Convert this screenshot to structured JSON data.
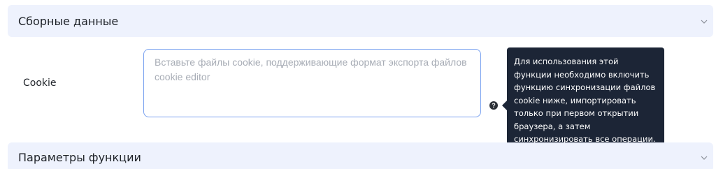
{
  "sections": {
    "combined": {
      "title": "Сборные данные",
      "icon": "chevron-down-icon"
    },
    "feature_params": {
      "title": "Параметры функции",
      "icon": "chevron-down-icon"
    }
  },
  "cookie": {
    "label": "Cookie",
    "value": "",
    "placeholder": "Вставьте файлы cookie, поддерживающие формат экспорта файлов cookie editor",
    "help_icon": "question-circle-icon",
    "tooltip": "Для использования этой функции необходимо включить функцию синхронизации файлов cookie ниже, импортировать только при первом открытии браузера, а затем синхронизировать все операции."
  },
  "colors": {
    "section_bg": "#eef2fd",
    "input_border": "#7aa2f0",
    "tooltip_bg": "#1c2536",
    "placeholder": "#a8adb6"
  }
}
